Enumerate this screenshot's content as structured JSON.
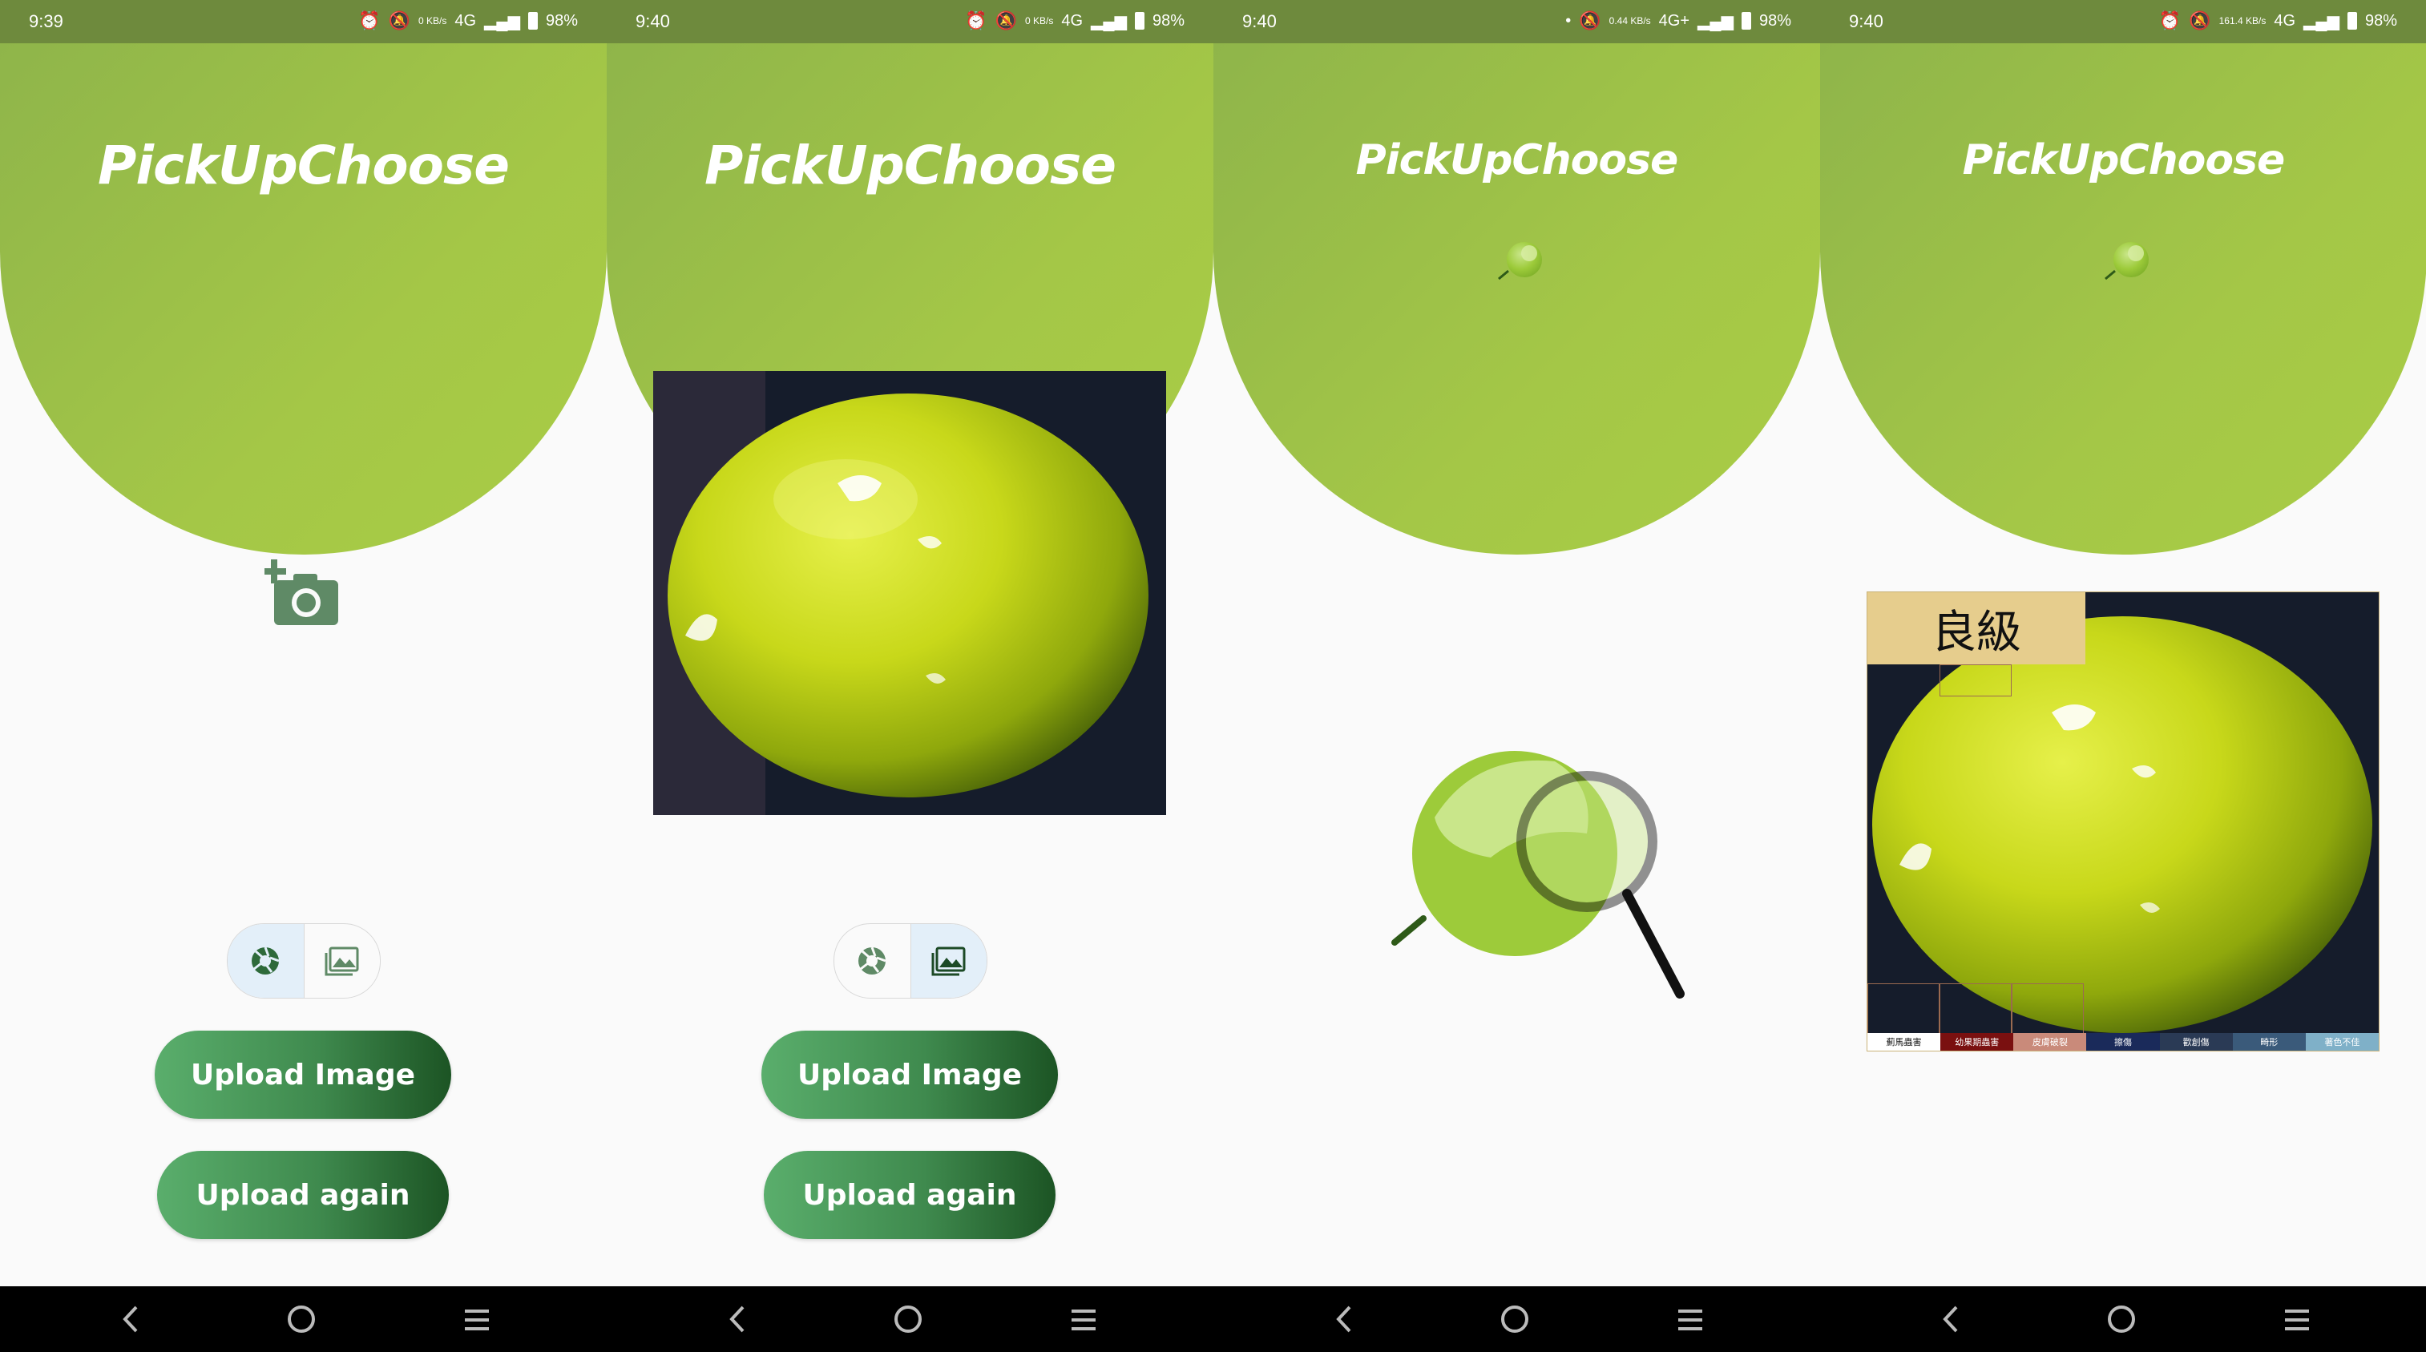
{
  "screens": [
    {
      "time": "9:39",
      "speed": "0 KB/s",
      "network": "4G",
      "battery": "98%"
    },
    {
      "time": "9:40",
      "speed": "0 KB/s",
      "network": "4G",
      "battery": "98%"
    },
    {
      "time": "9:40",
      "speed": "0.44 KB/s",
      "network": "4G+",
      "battery": "98%"
    },
    {
      "time": "9:40",
      "speed": "161.4 KB/s",
      "network": "4G",
      "battery": "98%"
    }
  ],
  "app": {
    "title": "PickUpChoose"
  },
  "buttons": {
    "upload_image": "Upload Image",
    "upload_again": "Upload again"
  },
  "result": {
    "grade": "良級",
    "legend": [
      {
        "label": "薊馬蟲害",
        "color": "#ffffff",
        "text_color": "#111111"
      },
      {
        "label": "幼果期蟲害",
        "color": "#7a1010",
        "text_color": "#ffffff"
      },
      {
        "label": "皮膚破裂",
        "color": "#c98a7a",
        "text_color": "#ffffff"
      },
      {
        "label": "擦傷",
        "color": "#1a2a5a",
        "text_color": "#ffffff"
      },
      {
        "label": "歡創傷",
        "color": "#2a3a55",
        "text_color": "#ffffff"
      },
      {
        "label": "畸形",
        "color": "#3a5a7a",
        "text_color": "#ffffff"
      },
      {
        "label": "著色不佳",
        "color": "#7fb0c8",
        "text_color": "#ffffff"
      }
    ]
  },
  "icons": {
    "status": [
      "alarm-icon",
      "mute-icon",
      "signal-icon",
      "battery-icon"
    ],
    "add_photo": "add-photo-icon",
    "camera": "shutter-icon",
    "gallery": "gallery-icon",
    "nav": [
      "back-icon",
      "home-icon",
      "recents-icon"
    ]
  },
  "colors": {
    "header_green": "#a4c747",
    "status_bar": "#6e8a3d",
    "button_gradient_start": "#5aae6c",
    "button_gradient_end": "#1c5424",
    "segment_selected": "#e3eff9",
    "icon_green": "#5a8a5e"
  }
}
